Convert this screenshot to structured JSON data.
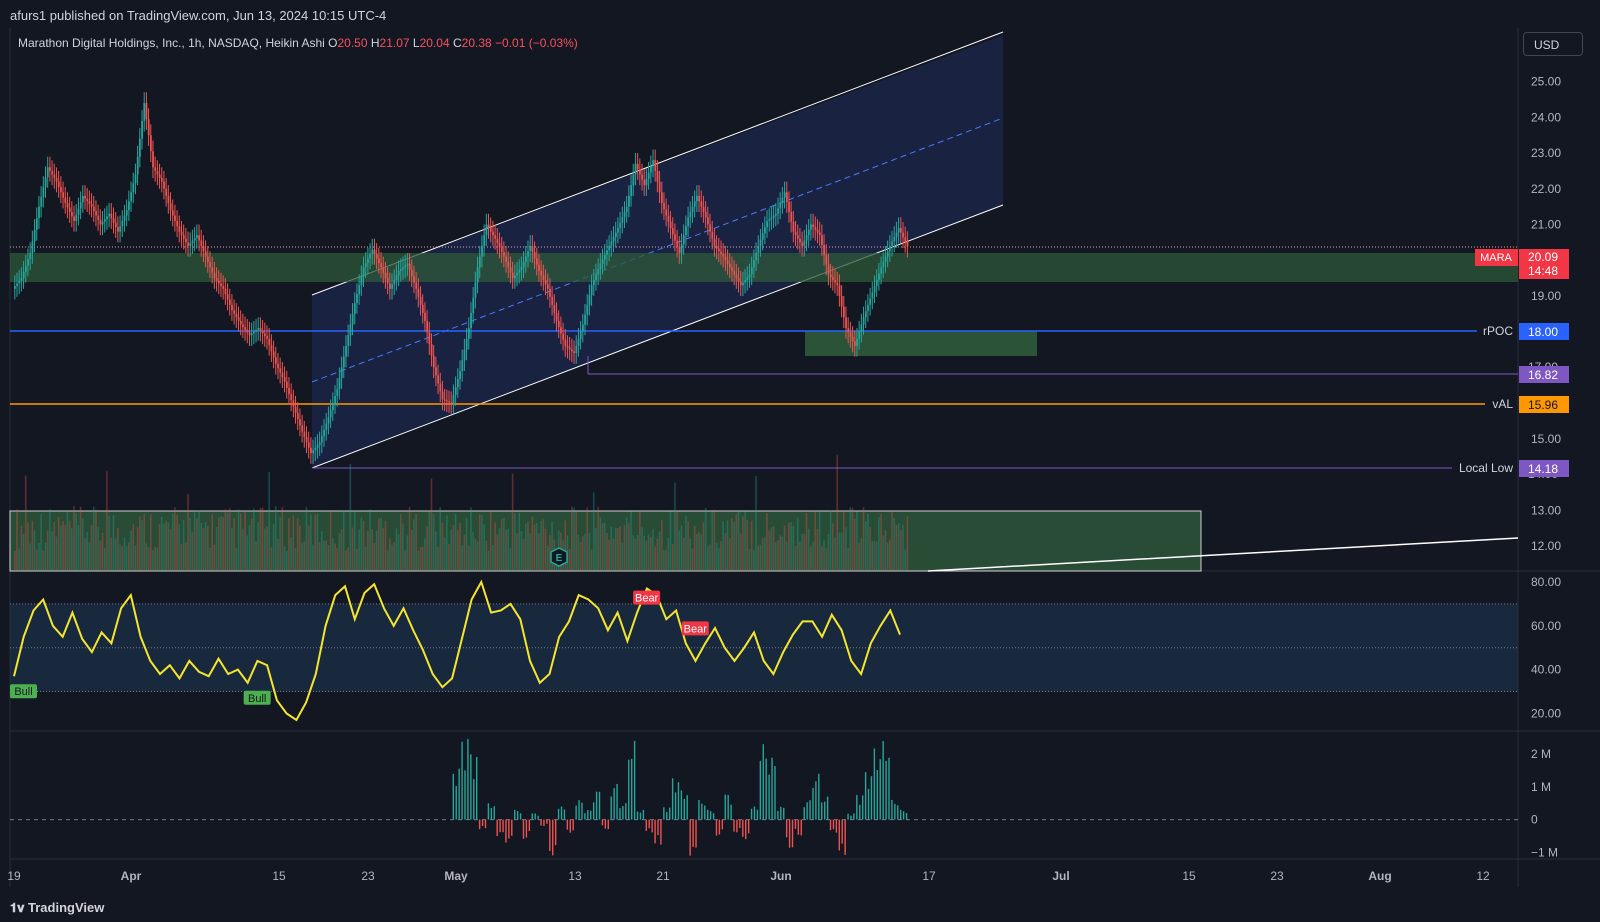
{
  "header": {
    "published": "afurs1 published on TradingView.com, Jun 13, 2024 10:15 UTC-4"
  },
  "legend": {
    "symbol": "Marathon Digital Holdings, Inc., 1h, NASDAQ, Heikin Ashi",
    "o_label": "O",
    "o_val": "20.50",
    "h_label": "H",
    "h_val": "21.07",
    "l_label": "L",
    "l_val": "20.04",
    "c_label": "C",
    "c_val": "20.38",
    "change": "−0.01 (−0.03%)"
  },
  "currency_button": "USD",
  "footer": {
    "brand": "TradingView"
  },
  "colors": {
    "background": "#131722",
    "up": "#26a69a",
    "down": "#ef5350",
    "channel": "#ffffff",
    "channel_fill": "#1a2340",
    "rpoc": "#2962ff",
    "val": "#ff9800",
    "zone": "#2e5a3a",
    "rsi": "#f5e52e",
    "level_purple": "#7e57c2"
  },
  "chart_data": [
    {
      "type": "candlestick",
      "name": "price",
      "x_ticks": [
        "19",
        "Apr",
        "15",
        "23",
        "May",
        "13",
        "21",
        "Jun",
        "17",
        "Jul",
        "15",
        "23",
        "Aug",
        "12"
      ],
      "y_ticks": [
        "25.00",
        "24.00",
        "23.00",
        "22.00",
        "21.00",
        "19.00",
        "15.00",
        "13.00",
        "12.00"
      ],
      "ylim": [
        11.3,
        26.5
      ],
      "closes": [
        19.5,
        20.2,
        21.5,
        22.6,
        22.2,
        21.6,
        21.1,
        21.8,
        21.5,
        21.0,
        21.3,
        20.8,
        21.4,
        22.4,
        24.4,
        22.6,
        22.2,
        21.4,
        20.8,
        20.4,
        20.7,
        20.1,
        19.5,
        19.2,
        18.6,
        18.2,
        17.9,
        18.1,
        17.8,
        17.1,
        16.6,
        15.9,
        15.2,
        14.6,
        14.9,
        15.6,
        16.4,
        17.6,
        18.8,
        19.8,
        20.3,
        19.8,
        19.2,
        19.7,
        19.9,
        19.2,
        18.3,
        17.0,
        16.1,
        16.0,
        16.9,
        18.1,
        19.8,
        21.0,
        20.6,
        20.1,
        19.5,
        19.8,
        20.4,
        19.7,
        19.2,
        18.3,
        17.6,
        17.4,
        18.2,
        19.3,
        19.9,
        20.4,
        20.9,
        21.5,
        22.7,
        22.1,
        22.8,
        21.6,
        20.9,
        20.2,
        21.2,
        21.8,
        21.2,
        20.4,
        20.1,
        19.7,
        19.3,
        19.6,
        20.4,
        21.1,
        21.3,
        21.9,
        20.8,
        20.4,
        21.0,
        20.7,
        19.6,
        19.3,
        18.1,
        17.6,
        18.4,
        19.1,
        19.8,
        20.4,
        20.9,
        20.38
      ],
      "last_price_label": "20.09",
      "countdown": "14:48",
      "ticker": "MARA"
    },
    {
      "type": "line",
      "name": "RSI",
      "y_ticks": [
        "80.00",
        "60.00",
        "40.00",
        "20.00"
      ],
      "ylim": [
        12,
        85
      ],
      "band": [
        30,
        70
      ],
      "values": [
        37,
        55,
        67,
        72,
        60,
        55,
        66,
        54,
        48,
        57,
        52,
        68,
        74,
        55,
        44,
        38,
        42,
        36,
        44,
        39,
        37,
        45,
        38,
        40,
        34,
        44,
        42,
        26,
        20,
        17,
        25,
        38,
        60,
        74,
        78,
        63,
        75,
        79,
        68,
        60,
        68,
        58,
        49,
        38,
        32,
        36,
        54,
        72,
        80,
        66,
        67,
        70,
        63,
        44,
        34,
        38,
        55,
        62,
        74,
        72,
        68,
        58,
        66,
        53,
        66,
        77,
        74,
        63,
        67,
        52,
        44,
        52,
        59,
        50,
        44,
        50,
        57,
        44,
        38,
        48,
        56,
        62,
        62,
        55,
        65,
        58,
        44,
        38,
        52,
        60,
        67,
        56
      ],
      "signals": [
        {
          "label": "Bull",
          "kind": "bull",
          "index": 0
        },
        {
          "label": "Bull",
          "kind": "bull",
          "index": 24
        },
        {
          "label": "Bear",
          "kind": "bear",
          "index": 64
        },
        {
          "label": "Bear",
          "kind": "bear",
          "index": 69
        }
      ]
    },
    {
      "type": "bar",
      "name": "Volume delta",
      "y_ticks": [
        "2 M",
        "1 M",
        "0",
        "−1 M"
      ],
      "ylim": [
        -1.2,
        2.7
      ],
      "values": [
        0,
        0,
        0,
        0,
        0,
        0,
        0,
        0,
        0,
        0,
        0,
        0,
        0,
        0,
        0,
        0,
        0,
        0,
        0,
        0,
        0,
        0,
        0,
        0,
        0,
        0,
        0,
        0,
        0,
        0,
        0,
        0,
        0,
        0,
        0,
        0,
        0,
        0,
        0,
        0,
        0,
        0,
        0,
        0,
        0,
        0,
        0,
        0,
        0,
        0,
        1.6,
        2.6,
        2.1,
        -0.3,
        0.5,
        -0.5,
        -0.7,
        0.3,
        -0.6,
        0.2,
        -0.2,
        -1.1,
        0.4,
        -0.4,
        0.6,
        0.3,
        0.9,
        -0.3,
        1.1,
        0.5,
        2.4,
        0.3,
        -0.4,
        -0.8,
        0.4,
        1.3,
        0.9,
        -1.1,
        0.6,
        0.3,
        -0.5,
        0.8,
        -0.4,
        -0.6,
        0.4,
        2.3,
        1.9,
        0.4,
        -0.9,
        -0.5,
        0.6,
        1.4,
        0.7,
        -0.4,
        -1.1,
        0.2,
        0.8,
        1.5,
        2.2,
        2.4,
        0.6,
        0.3
      ]
    }
  ],
  "levels": {
    "rpoc": {
      "label": "rPOC",
      "price": "18.00"
    },
    "purple": {
      "label": "",
      "price": "16.82",
      "partial_tick": "17.00"
    },
    "val": {
      "label": "vAL",
      "price": "15.96"
    },
    "local_low": {
      "label": "Local Low",
      "price": "14.18",
      "partial_tick": "14.00"
    }
  },
  "event_badge": "E"
}
